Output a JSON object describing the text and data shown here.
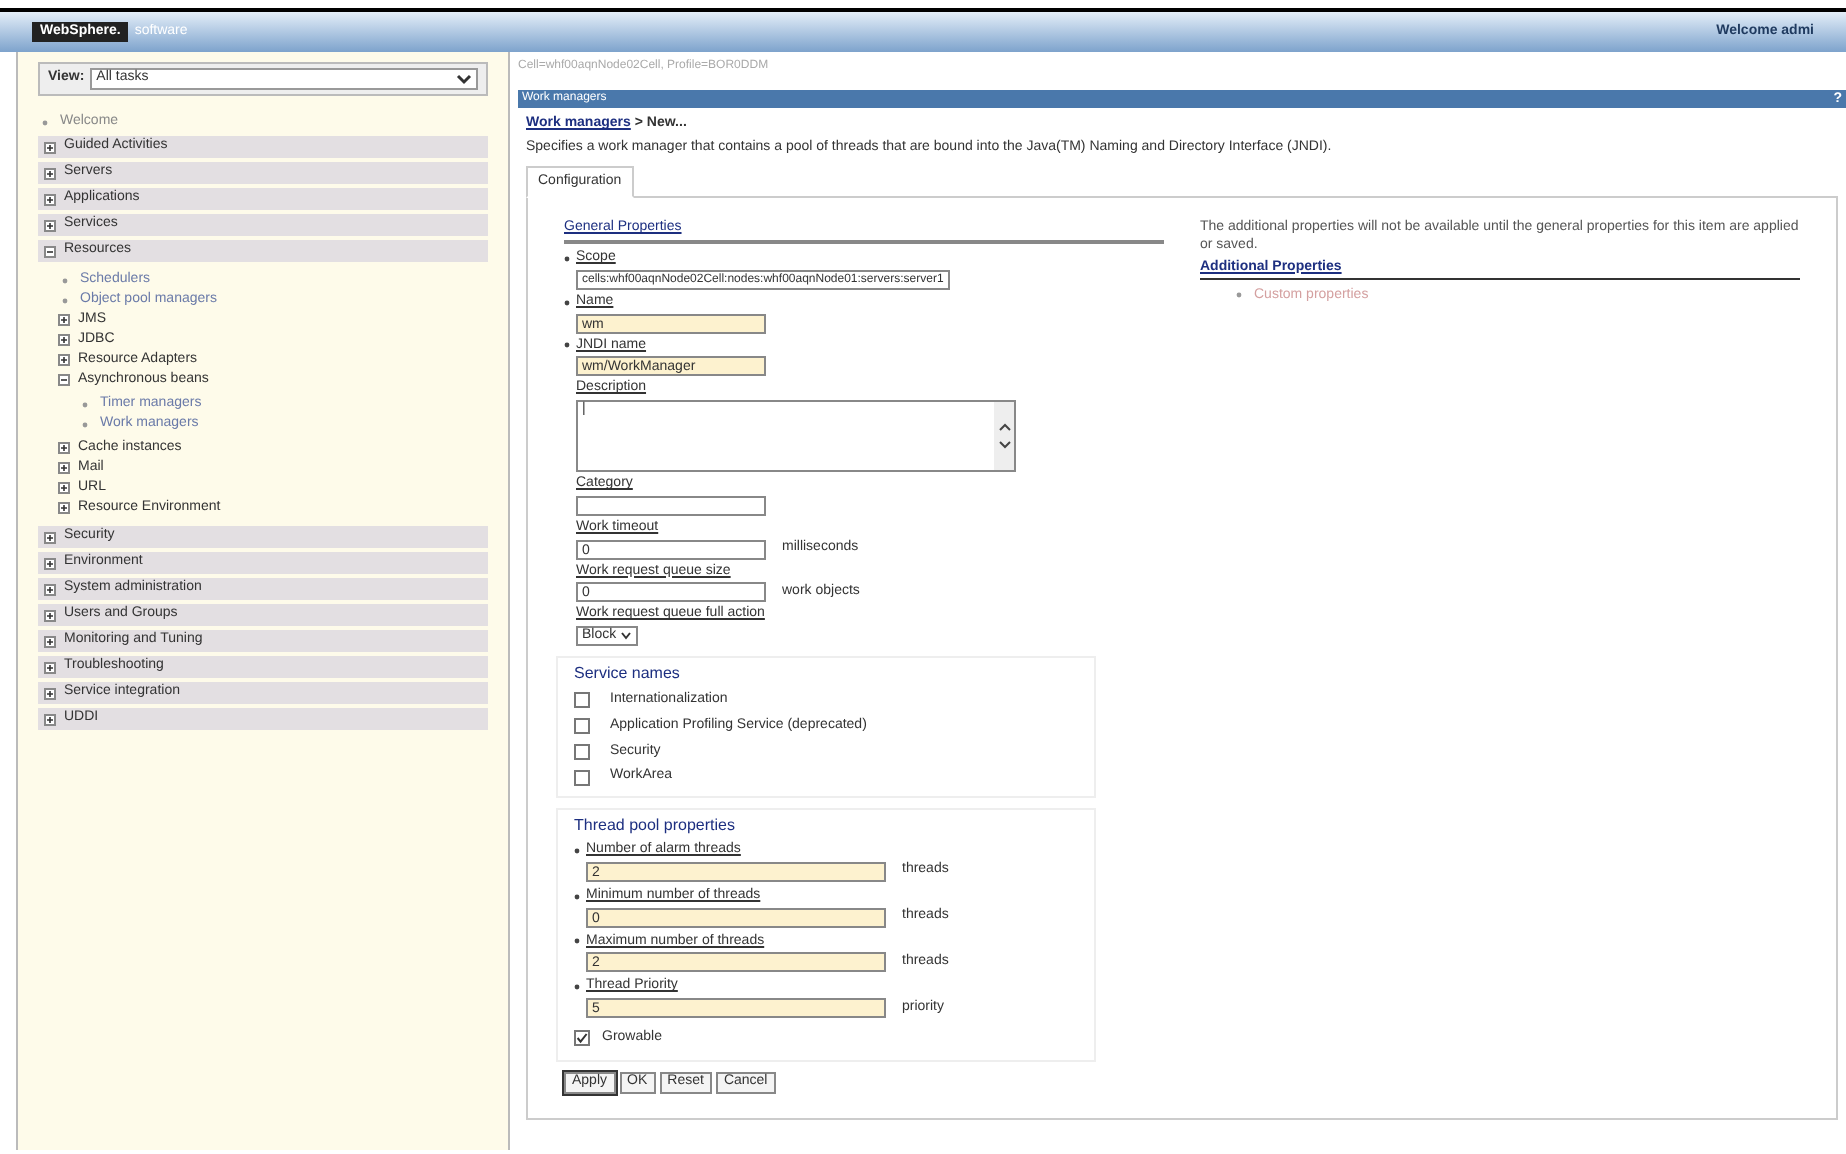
{
  "header": {
    "logo": "WebSphere.",
    "product": "software",
    "welcome": "Welcome admi"
  },
  "view": {
    "label": "View:",
    "value": "All tasks"
  },
  "nav": [
    {
      "label": "Welcome",
      "kind": "link"
    },
    {
      "label": "Guided Activities",
      "kind": "section",
      "expanded": false
    },
    {
      "label": "Servers",
      "kind": "section",
      "expanded": false
    },
    {
      "label": "Applications",
      "kind": "section",
      "expanded": false
    },
    {
      "label": "Services",
      "kind": "section",
      "expanded": false
    },
    {
      "label": "Resources",
      "kind": "section",
      "expanded": true,
      "children": [
        {
          "label": "Schedulers",
          "kind": "link"
        },
        {
          "label": "Object pool managers",
          "kind": "link"
        },
        {
          "label": "JMS",
          "kind": "folder",
          "expanded": false
        },
        {
          "label": "JDBC",
          "kind": "folder",
          "expanded": false
        },
        {
          "label": "Resource Adapters",
          "kind": "folder",
          "expanded": false
        },
        {
          "label": "Asynchronous beans",
          "kind": "folder",
          "expanded": true,
          "children": [
            {
              "label": "Timer managers",
              "kind": "link"
            },
            {
              "label": "Work managers",
              "kind": "link"
            }
          ]
        },
        {
          "label": "Cache instances",
          "kind": "folder",
          "expanded": false
        },
        {
          "label": "Mail",
          "kind": "folder",
          "expanded": false
        },
        {
          "label": "URL",
          "kind": "folder",
          "expanded": false
        },
        {
          "label": "Resource Environment",
          "kind": "folder",
          "expanded": false
        }
      ]
    },
    {
      "label": "Security",
      "kind": "section",
      "expanded": false
    },
    {
      "label": "Environment",
      "kind": "section",
      "expanded": false
    },
    {
      "label": "System administration",
      "kind": "section",
      "expanded": false
    },
    {
      "label": "Users and Groups",
      "kind": "section",
      "expanded": false
    },
    {
      "label": "Monitoring and Tuning",
      "kind": "section",
      "expanded": false
    },
    {
      "label": "Troubleshooting",
      "kind": "section",
      "expanded": false
    },
    {
      "label": "Service integration",
      "kind": "section",
      "expanded": false
    },
    {
      "label": "UDDI",
      "kind": "section",
      "expanded": false
    }
  ],
  "scope_path": "Cell=whf00aqnNode02Cell, Profile=BOR0DDM",
  "panel_title": "Work managers",
  "help": "?",
  "breadcrumb": {
    "link": "Work managers",
    "rest": "> New..."
  },
  "description": "Specifies a work manager that contains a pool of threads that are bound into the Java(TM) Naming and Directory Interface (JNDI).",
  "tabs": [
    {
      "label": "Configuration",
      "selected": true
    }
  ],
  "general": {
    "title": "General Properties",
    "fields": [
      {
        "kind": "readonly",
        "label": "Scope",
        "required": true,
        "value": "cells:whf00aqnNode02Cell:nodes:whf00aqnNode01:servers:server1"
      },
      {
        "kind": "text",
        "label": "Name",
        "required": true,
        "value": "wm"
      },
      {
        "kind": "text",
        "label": "JNDI name",
        "required": true,
        "value": "wm/WorkManager"
      },
      {
        "kind": "textarea",
        "label": "Description",
        "required": false,
        "value": "|"
      },
      {
        "kind": "text",
        "label": "Category",
        "required": false
      },
      {
        "kind": "text",
        "label": "Work timeout",
        "required": false,
        "value": "0",
        "unit": "milliseconds"
      },
      {
        "kind": "text",
        "label": "Work request queue size",
        "required": false,
        "value": "0",
        "unit": "work objects"
      },
      {
        "kind": "select",
        "label": "Work request queue full action",
        "required": false,
        "value": "Block"
      }
    ]
  },
  "service_names": {
    "title": "Service names",
    "items": [
      {
        "label": "Internationalization",
        "checked": false
      },
      {
        "label": "Application Profiling Service (deprecated)",
        "checked": false
      },
      {
        "label": "Security",
        "checked": false
      },
      {
        "label": "WorkArea",
        "checked": false
      }
    ]
  },
  "thread_pool": {
    "title": "Thread pool properties",
    "fields": [
      {
        "label": "Number of alarm threads",
        "required": true,
        "value": "2",
        "unit": "threads"
      },
      {
        "label": "Minimum number of threads",
        "required": true,
        "value": "0",
        "unit": "threads"
      },
      {
        "label": "Maximum number of threads",
        "required": true,
        "value": "2",
        "unit": "threads"
      },
      {
        "label": "Thread Priority",
        "required": true,
        "value": "5",
        "unit": "priority"
      }
    ],
    "growable": {
      "label": "Growable",
      "checked": true
    }
  },
  "additional": {
    "note": "The additional properties will not be available until the general properties for this item are applied or saved.",
    "title": "Additional Properties",
    "links": [
      "Custom properties"
    ]
  },
  "buttons": [
    "Apply",
    "OK",
    "Reset",
    "Cancel"
  ]
}
